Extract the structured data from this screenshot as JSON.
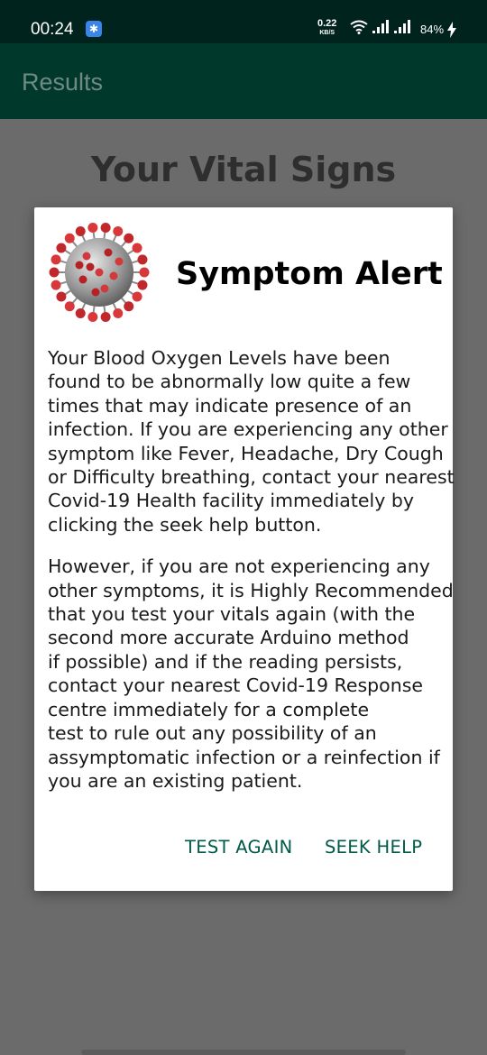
{
  "status_bar": {
    "time": "00:24",
    "net_speed_value": "0.22",
    "net_speed_unit": "KB/S",
    "battery": "84%",
    "icons": [
      "notification-icon",
      "wifi-icon",
      "signal-icon",
      "signal-icon",
      "charging-icon"
    ]
  },
  "app_bar": {
    "title": "Results"
  },
  "page": {
    "heading": "Your Vital Signs"
  },
  "dialog": {
    "image": "coronavirus-icon",
    "title": "Symptom Alert",
    "paragraph1_lines": [
      "Your Blood Oxygen Levels have been",
      "found to be abnormally low quite a few",
      "times that may indicate presence of an",
      "infection. If you are experiencing any other",
      "symptom like Fever, Headache, Dry Cough",
      "or Difficulty breathing, contact your nearest",
      "Covid-19 Health facility immediately by",
      "clicking the seek help button."
    ],
    "paragraph2_lines": [
      "However, if you are not experiencing any",
      "other symptoms, it is Highly Recommended",
      "that you test your vitals again (with the",
      "second more accurate Arduino method",
      "if possible) and if the reading persists,",
      "contact your nearest Covid-19 Response",
      "centre immediately for a complete",
      "test to rule out any possibility of an",
      "assymptomatic infection or a reinfection if",
      "you are an existing patient."
    ],
    "buttons": {
      "test_again": "TEST AGAIN",
      "seek_help": "SEEK HELP"
    }
  },
  "colors": {
    "status_bar": "#00241d",
    "app_bar": "#00382c",
    "accent": "#005a48",
    "scrim": "#6b6b6b"
  }
}
